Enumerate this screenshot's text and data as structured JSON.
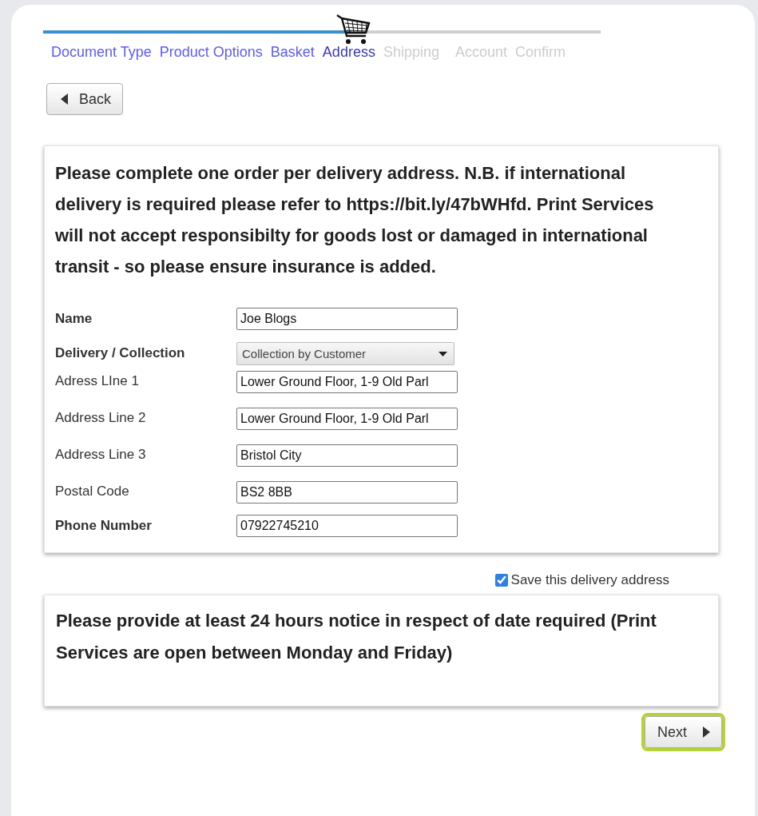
{
  "progress": {
    "level": 0.553
  },
  "steps": [
    {
      "label": "Document Type",
      "completed": true,
      "selected": false
    },
    {
      "label": "Product Options",
      "completed": true,
      "selected": false
    },
    {
      "label": "Basket",
      "completed": true,
      "selected": false
    },
    {
      "label": "Address",
      "completed": false,
      "selected": true
    },
    {
      "label": "Shipping",
      "completed": false,
      "selected": false
    },
    {
      "label": "Account",
      "completed": false,
      "selected": false
    },
    {
      "label": "Confirm",
      "completed": false,
      "selected": false
    }
  ],
  "back_button": {
    "label": "Back"
  },
  "address_card": {
    "notice": "Please complete one order per delivery address. N.B. if international delivery is required please refer to https://bit.ly/47bWHfd. Print Services will not accept responsibilty for goods lost or damaged in international transit - so please ensure insurance is added.",
    "fields": [
      {
        "label": "Name",
        "bold": true,
        "kind": "text",
        "value": "Joe Blogs"
      },
      {
        "label": "Delivery / Collection",
        "bold": true,
        "kind": "select",
        "value": "Collection by Customer"
      },
      {
        "label": "Adress LIne 1",
        "bold": false,
        "kind": "text",
        "value": "Lower Ground Floor, 1-9 Old Parl"
      },
      {
        "label": "Address Line 2",
        "bold": false,
        "kind": "text",
        "value": "Lower Ground Floor, 1-9 Old Parl"
      },
      {
        "label": "Address Line 3",
        "bold": false,
        "kind": "text",
        "value": "Bristol City"
      },
      {
        "label": "Postal Code",
        "bold": false,
        "kind": "text",
        "value": "BS2 8BB"
      },
      {
        "label": "Phone Number",
        "bold": true,
        "kind": "text",
        "value": "07922745210"
      }
    ]
  },
  "save_address": {
    "label": "Save this delivery address",
    "checked": true
  },
  "date_card": {
    "notice": "Please provide at least 24 hours notice in respect of date required (Print Services are open between Monday and Friday)"
  },
  "next_button": {
    "label": "Next",
    "focused": true
  }
}
